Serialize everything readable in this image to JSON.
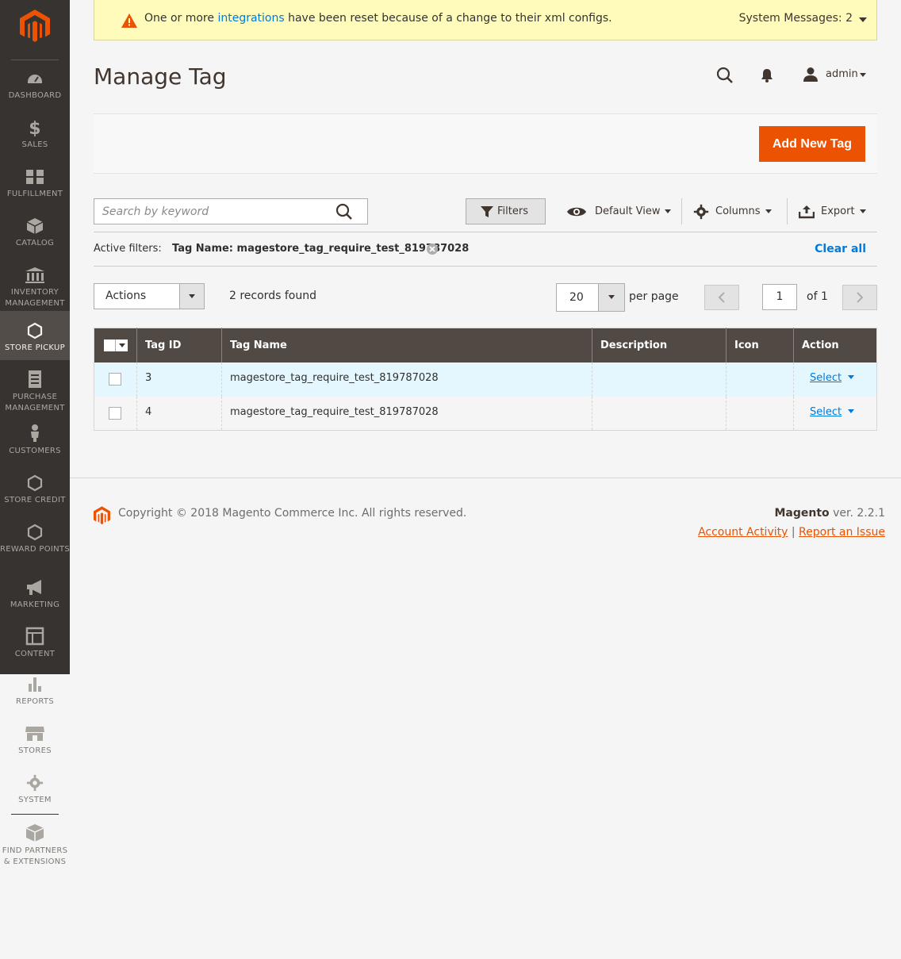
{
  "sidebar": {
    "items": [
      {
        "label": "DASHBOARD"
      },
      {
        "label": "SALES"
      },
      {
        "label": "FULFILLMENT"
      },
      {
        "label": "CATALOG"
      },
      {
        "label": "INVENTORY MANAGEMENT"
      },
      {
        "label": "STORE PICKUP"
      },
      {
        "label": "PURCHASE MANAGEMENT"
      },
      {
        "label": "CUSTOMERS"
      },
      {
        "label": "STORE CREDIT"
      },
      {
        "label": "REWARD POINTS"
      },
      {
        "label": "MARKETING"
      },
      {
        "label": "CONTENT"
      },
      {
        "label": "REPORTS"
      },
      {
        "label": "STORES"
      },
      {
        "label": "SYSTEM"
      },
      {
        "label": "FIND PARTNERS & EXTENSIONS"
      }
    ],
    "active": "STORE PICKUP"
  },
  "message": {
    "prefix": "One or more",
    "link": "integrations",
    "suffix": "have been reset because of a change to their xml configs.",
    "system": "System Messages: 2"
  },
  "header": {
    "title": "Manage Tag",
    "user": "admin"
  },
  "page_actions": {
    "add_label": "Add New Tag"
  },
  "toolbar": {
    "search_placeholder": "Search by keyword",
    "filters": "Filters",
    "view": "Default View",
    "columns": "Columns",
    "export": "Export"
  },
  "active_filters": {
    "label": "Active filters:",
    "chip": "Tag Name: magestore_tag_require_test_819787028",
    "clear": "Clear all"
  },
  "grid_controls": {
    "actions": "Actions",
    "records": "2 records found",
    "per_page_value": "20",
    "per_page_label": "per page",
    "page": "1",
    "of": "of 1"
  },
  "grid": {
    "columns": [
      "Tag ID",
      "Tag Name",
      "Description",
      "Icon",
      "Action"
    ],
    "rows": [
      {
        "id": "3",
        "name": "magestore_tag_require_test_819787028",
        "description": "",
        "icon": "",
        "action": "Select"
      },
      {
        "id": "4",
        "name": "magestore_tag_require_test_819787028",
        "description": "",
        "icon": "",
        "action": "Select"
      }
    ]
  },
  "footer": {
    "copyright": "Copyright © 2018 Magento Commerce Inc. All rights reserved.",
    "brand": "Magento",
    "version": "ver. 2.2.1",
    "link_activity": "Account Activity",
    "separator": "|",
    "link_issue": "Report an Issue"
  },
  "colors": {
    "accent": "#eb5202",
    "link": "#007bdb",
    "sidebar_bg": "#373330",
    "grid_header": "#514943"
  }
}
